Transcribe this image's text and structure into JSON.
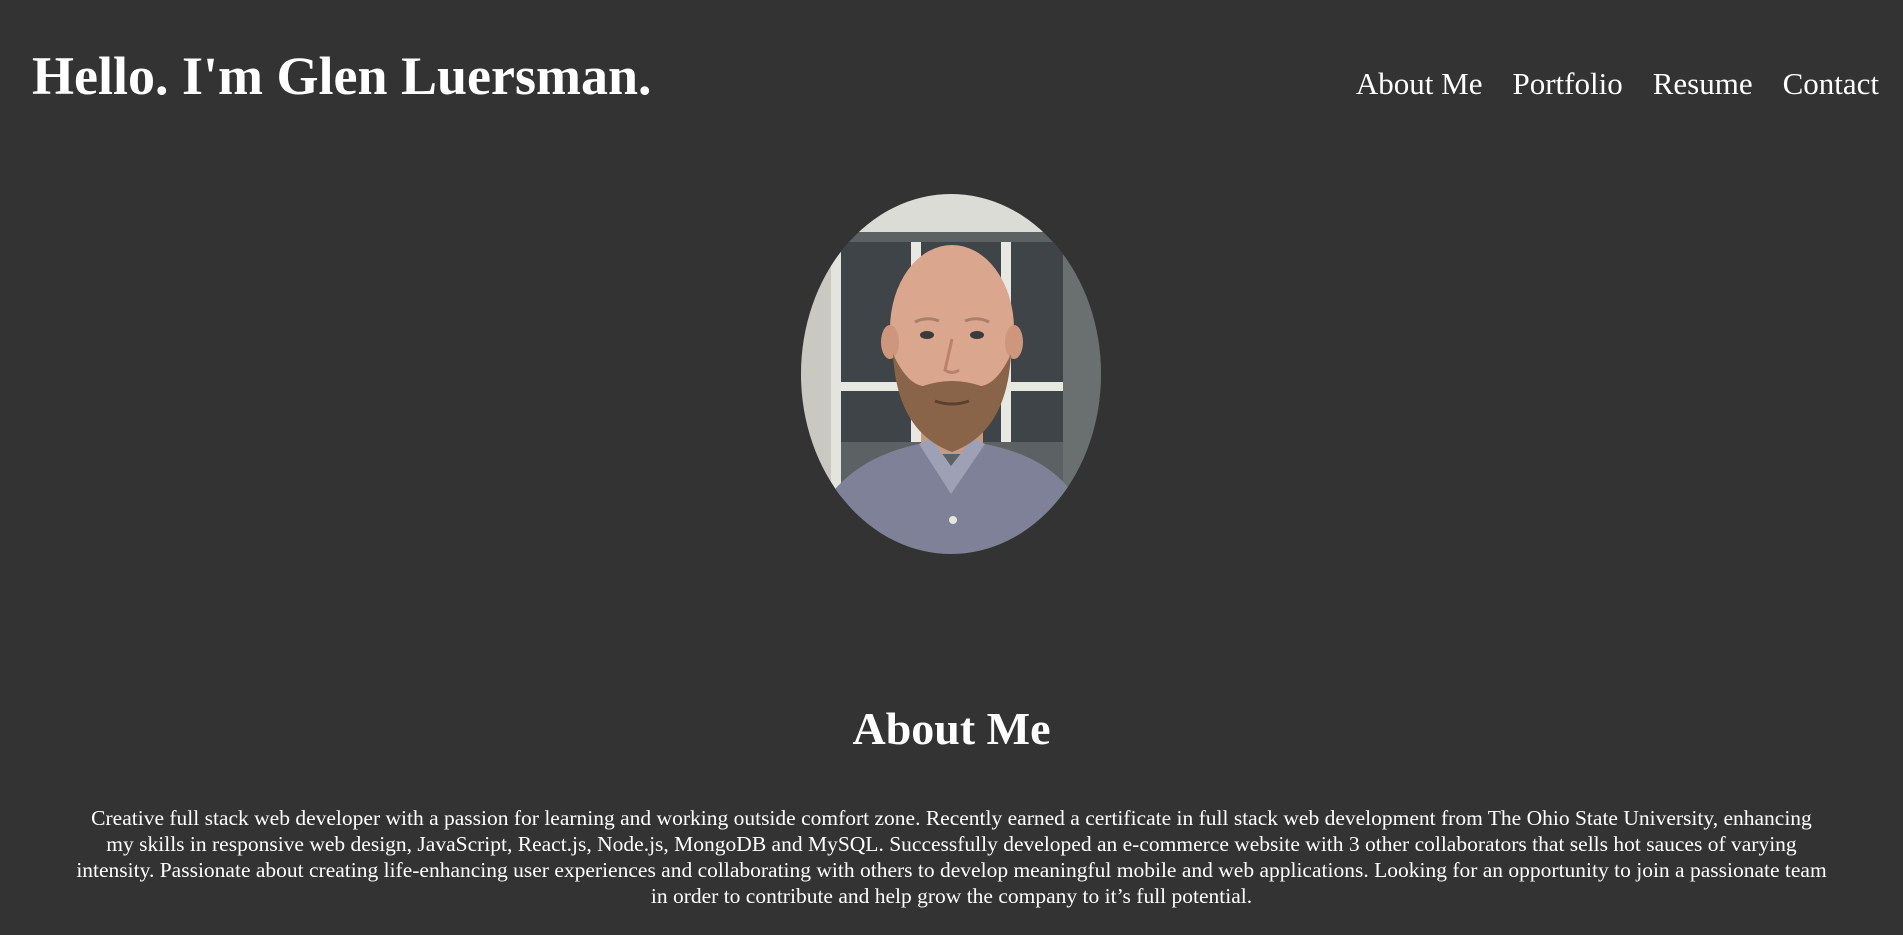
{
  "header": {
    "title": "Hello. I'm Glen Luersman."
  },
  "nav": {
    "items": [
      {
        "label": "About Me"
      },
      {
        "label": "Portfolio"
      },
      {
        "label": "Resume"
      },
      {
        "label": "Contact"
      }
    ]
  },
  "profile": {
    "photo_subject": "profile photo"
  },
  "about": {
    "heading": "About Me",
    "body": "Creative full stack web developer with a passion for learning and working outside comfort zone. Recently earned a certificate in full stack web development from The Ohio State University, enhancing my skills in responsive web design, JavaScript, React.js, Node.js, MongoDB and MySQL. Successfully developed an e-commerce website with 3 other collaborators that sells hot sauces of varying intensity. Passionate about creating life-enhancing user experiences and collaborating with others to develop meaningful mobile and web applications. Looking for an opportunity to join a passionate team in order to contribute and help grow the company to it’s full potential."
  },
  "colors": {
    "background": "#333333",
    "text": "#ffffff"
  }
}
